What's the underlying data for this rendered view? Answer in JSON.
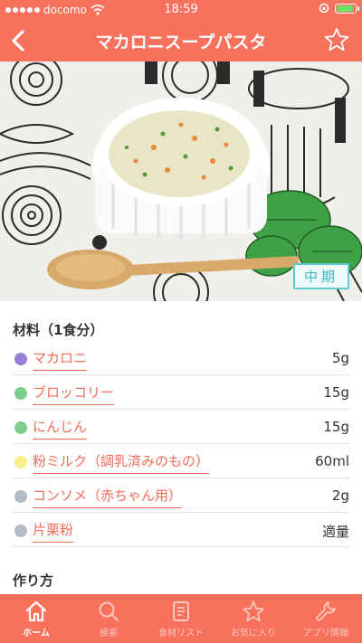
{
  "status": {
    "carrier": "docomo",
    "time": "18:59"
  },
  "nav": {
    "title": "マカロニスープパスタ"
  },
  "hero": {
    "stage_badge": "中期"
  },
  "ingredients": {
    "title": "材料（1食分）",
    "items": [
      {
        "name": "マカロニ",
        "amount": "5g",
        "dot_color": "#9b7fd4"
      },
      {
        "name": "ブロッコリー",
        "amount": "15g",
        "dot_color": "#7ccf8a"
      },
      {
        "name": "にんじん",
        "amount": "15g",
        "dot_color": "#7ccf8a"
      },
      {
        "name": "粉ミルク（調乳済みのもの）",
        "amount": "60ml",
        "dot_color": "#f7ef8a"
      },
      {
        "name": "コンソメ（赤ちゃん用）",
        "amount": "2g",
        "dot_color": "#b3bcc4"
      },
      {
        "name": "片栗粉",
        "amount": "適量",
        "dot_color": "#b3bcc4"
      }
    ]
  },
  "method": {
    "title": "作り方"
  },
  "tabbar": {
    "tabs": [
      {
        "label": "ホーム",
        "icon": "home-icon",
        "active": true
      },
      {
        "label": "検索",
        "icon": "search-icon",
        "active": false
      },
      {
        "label": "食材リスト",
        "icon": "list-icon",
        "active": false
      },
      {
        "label": "お気に入り",
        "icon": "star-icon",
        "active": false
      },
      {
        "label": "アプリ情報",
        "icon": "wrench-icon",
        "active": false
      }
    ]
  },
  "colors": {
    "accent": "#f7715d",
    "link": "#f36b57",
    "badge": "#5fcad2"
  }
}
